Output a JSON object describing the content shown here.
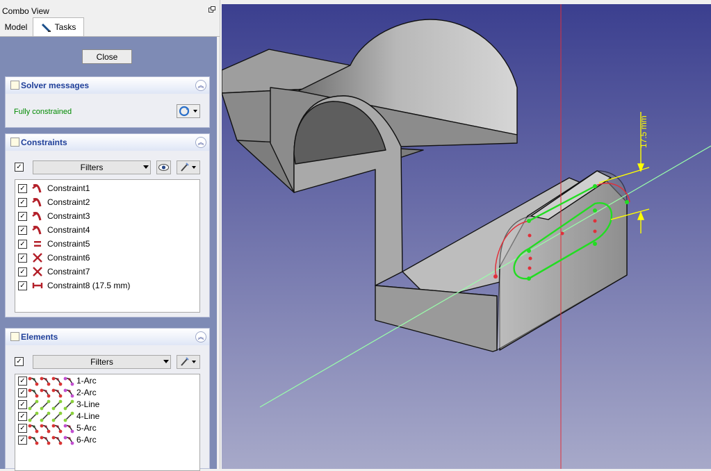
{
  "combo_view": {
    "title": "Combo View"
  },
  "tabs": [
    {
      "label": "Model"
    },
    {
      "label": "Tasks"
    }
  ],
  "close_label": "Close",
  "solver": {
    "title": "Solver messages",
    "message": "Fully constrained"
  },
  "constraints": {
    "title": "Constraints",
    "filters_label": "Filters",
    "items": [
      {
        "label": "Constraint1",
        "icon": "tangent-icon"
      },
      {
        "label": "Constraint2",
        "icon": "tangent-icon"
      },
      {
        "label": "Constraint3",
        "icon": "tangent-icon"
      },
      {
        "label": "Constraint4",
        "icon": "tangent-icon"
      },
      {
        "label": "Constraint5",
        "icon": "equal-icon"
      },
      {
        "label": "Constraint6",
        "icon": "symmetric-icon"
      },
      {
        "label": "Constraint7",
        "icon": "symmetric-icon"
      },
      {
        "label": "Constraint8 (17.5 mm)",
        "icon": "distance-icon"
      }
    ]
  },
  "elements": {
    "title": "Elements",
    "filters_label": "Filters",
    "items": [
      {
        "label": "1-Arc",
        "icon": "arc-icon"
      },
      {
        "label": "2-Arc",
        "icon": "arc-icon"
      },
      {
        "label": "3-Line",
        "icon": "line-icon"
      },
      {
        "label": "4-Line",
        "icon": "line-icon"
      },
      {
        "label": "5-Arc",
        "icon": "arc-icon"
      },
      {
        "label": "6-Arc",
        "icon": "arc-icon"
      }
    ]
  },
  "viewport": {
    "dimension_label": "17.5 mm"
  },
  "colors": {
    "taskpane_bg": "#7e8bb5",
    "panel_title": "#1f3f99",
    "solver_ok": "#008a00",
    "constraint_icon": "#b3202a",
    "sketch_green": "#22dd22",
    "dimension_yellow": "#ffff00",
    "axis_red": "#e0303a",
    "bg_top": "#3b3f8f",
    "bg_bottom": "#a7a9c9"
  }
}
